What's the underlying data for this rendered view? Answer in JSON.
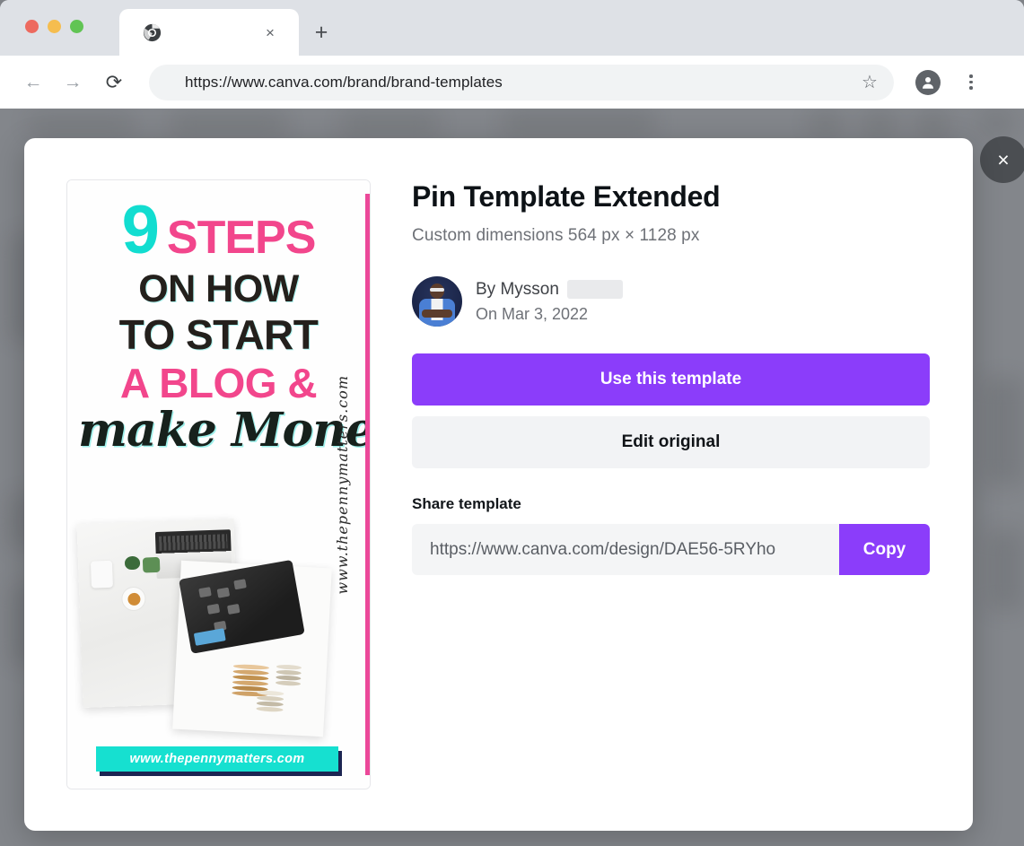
{
  "browser": {
    "tab": {
      "favicon": "chrome-logo-icon",
      "title": "",
      "close_label": "×"
    },
    "new_tab_label": "+",
    "nav": {
      "back": "←",
      "forward": "→",
      "reload": "⟳"
    },
    "omnibox": {
      "url": "https://www.canva.com/brand/brand-templates",
      "star": "☆"
    },
    "profile_icon": "person-icon",
    "menu_icon": "kebab-menu-icon"
  },
  "modal": {
    "close_label": "×",
    "title": "Pin Template Extended",
    "dimensions": "Custom dimensions 564 px × 1128 px",
    "author": {
      "by_label": "By Mysson",
      "date": "On Mar 3, 2022",
      "avatar_name": "author-avatar"
    },
    "primary_button": "Use this template",
    "secondary_button": "Edit original",
    "share": {
      "label": "Share template",
      "url": "https://www.canva.com/design/DAE56-5RYho",
      "copy_label": "Copy"
    },
    "colors": {
      "accent_purple": "#8b3dfa",
      "secondary_grey": "#f2f3f5",
      "close_circle": "#4b4e52"
    }
  },
  "preview": {
    "headline": {
      "number": "9",
      "steps": "STEPS",
      "line2": "ON HOW",
      "line3": "TO START",
      "line4": "A BLOG &",
      "line5": "make Money"
    },
    "url_banner": "www.thepennymatters.com",
    "side_url": "www.thepennymatters.com",
    "colors": {
      "teal": "#12ddd0",
      "pink": "#f2468c",
      "dark": "#24201c",
      "banner_cyan": "#16e0d0",
      "edge_pink": "#ec4899"
    }
  }
}
